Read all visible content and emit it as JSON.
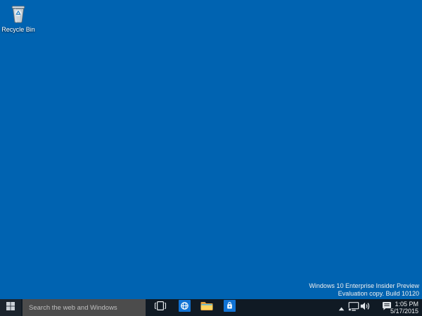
{
  "colors": {
    "desktop_background": "#0063B1",
    "taskbar_background": "#101A24",
    "search_box_background": "#4C4C4C",
    "app_tile_blue": "#1173D4",
    "folder_yellow": "#FFD45E"
  },
  "desktop": {
    "icons": [
      {
        "name": "recycle-bin",
        "icon": "recycle-bin-icon",
        "label": "Recycle Bin"
      }
    ],
    "watermark": {
      "line1": "Windows 10 Enterprise Insider Preview",
      "line2": "Evaluation copy. Build 10120"
    }
  },
  "taskbar": {
    "start": {
      "icon": "windows-logo-icon"
    },
    "search": {
      "placeholder": "Search the web and Windows"
    },
    "buttons": [
      {
        "name": "task-view",
        "icon": "task-view-icon"
      },
      {
        "name": "spartan-browser",
        "icon": "globe-icon"
      },
      {
        "name": "file-explorer",
        "icon": "folder-icon"
      },
      {
        "name": "windows-store",
        "icon": "shopping-bag-icon"
      }
    ],
    "tray": {
      "icons": [
        {
          "name": "show-hidden-icons",
          "icon": "chevron-up-icon"
        },
        {
          "name": "network",
          "icon": "ethernet-monitor-icon"
        },
        {
          "name": "volume",
          "icon": "speaker-icon"
        },
        {
          "name": "action-center",
          "icon": "message-square-icon"
        }
      ],
      "clock": {
        "time": "1:05 PM",
        "date": "5/17/2015"
      }
    }
  }
}
